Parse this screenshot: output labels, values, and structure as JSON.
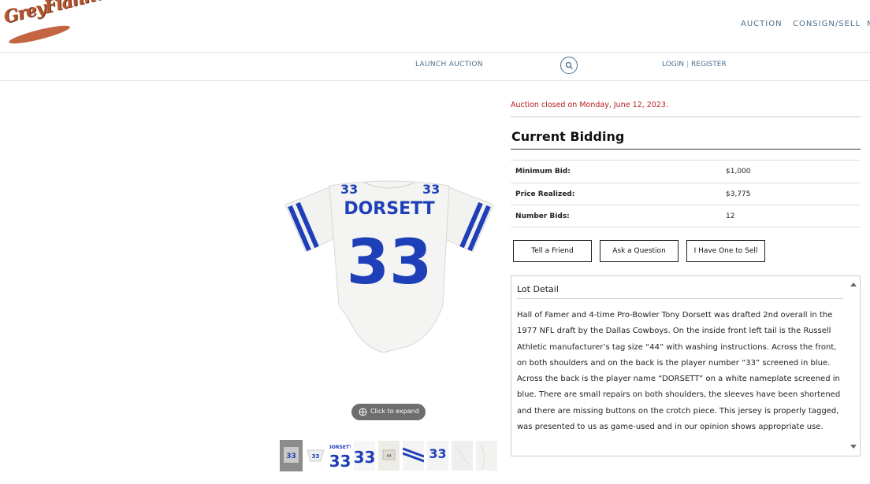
{
  "brand": {
    "logo_text": "GreyFlannel"
  },
  "header": {
    "nav": {
      "auction": "AUCTION",
      "consign": "CONSIGN/SELL",
      "more": "M"
    },
    "launch_auction": "LAUNCH AUCTION",
    "login": "LOGIN",
    "separator": "|",
    "register": "REGISTER"
  },
  "gallery": {
    "jersey_name": "DORSETT",
    "jersey_number": "33",
    "expand_label": "Click to expand",
    "thumbnail_count": 9,
    "colors": {
      "jersey_white": "#f2f2f0",
      "jersey_blue": "#1f3fb8"
    }
  },
  "lot": {
    "status": "Auction closed on Monday, June 12, 2023.",
    "bidding_title": "Current Bidding",
    "rows": [
      {
        "label": "Minimum Bid:",
        "value": "$1,000"
      },
      {
        "label": "Price Realized:",
        "value": "$3,775"
      },
      {
        "label": "Number Bids:",
        "value": "12"
      }
    ],
    "buttons": {
      "tell_friend": "Tell a Friend",
      "ask_question": "Ask a Question",
      "have_one": "I Have One to Sell"
    },
    "detail_title": "Lot Detail",
    "detail_text": "Hall of Famer and 4-time Pro-Bowler Tony Dorsett was drafted 2nd overall in the 1977 NFL draft by the Dallas Cowboys. On the inside front left tail is the Russell Athletic manufacturer’s tag size “44” with washing instructions. Across the front, on both shoulders and on the back is the player number “33” screened in blue. Across the back is the player name “DORSETT” on a white nameplate screened in blue. There are small repairs on both shoulders, the sleeves have been shortened and there are missing buttons on the crotch piece. This jersey is properly tagged, was presented to us as game-used and in our opinion shows appropriate use."
  },
  "colors": {
    "accent": "#4a6f8f",
    "closed": "#b51d1d",
    "logo": "#b5562e"
  }
}
